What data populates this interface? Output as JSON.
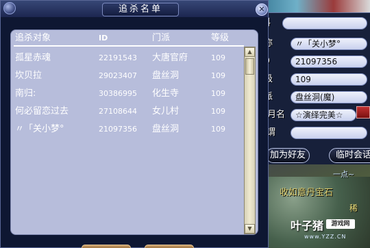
{
  "list_window": {
    "title": "追杀名单",
    "close_icon": "close-icon",
    "columns": {
      "name": "追杀对象",
      "id": "ID",
      "school": "门派",
      "level": "等级"
    },
    "rows": [
      {
        "name": "孤星赤魂",
        "id": "22191543",
        "school": "大唐官府",
        "level": "109"
      },
      {
        "name": "坎贝拉",
        "id": "29023407",
        "school": "盘丝洞",
        "level": "109"
      },
      {
        "name": "南归:",
        "id": "30386995",
        "school": "化生寺",
        "level": "109"
      },
      {
        "name": "何必留恋过去",
        "id": "27108644",
        "school": "女儿村",
        "level": "109"
      },
      {
        "name": "〃「关小梦°",
        "id": "21097356",
        "school": "盘丝洞",
        "level": "109"
      }
    ],
    "scrollbar": {
      "up_icon": "scroll-up-arrow-icon",
      "down_icon": "scroll-down-arrow-icon"
    }
  },
  "info_panel": {
    "fields": [
      {
        "label": "称",
        "value": "〃「关小梦°"
      },
      {
        "label": "ID",
        "value": "21097356"
      },
      {
        "label": "级",
        "value": "109"
      },
      {
        "label": "派",
        "value": "盘丝洞(魔)"
      },
      {
        "label": "月名",
        "value": "☆演绎完美☆"
      },
      {
        "label": "谓",
        "value": ""
      }
    ],
    "partial_header": "料",
    "buttons": {
      "add_friend": "加为好友",
      "temp_chat": "临时会话"
    }
  },
  "scene": {
    "text_a": "收如意丹宝石",
    "text_b": "一点~",
    "text_c": "稀"
  },
  "watermark": {
    "brand": "叶子猪",
    "tag": "游戏网",
    "url": "www.YZZ.CN"
  },
  "colors": {
    "window_bg": "#0e1732",
    "list_bg": "#b7bddb",
    "title_bar": "#2c3966",
    "text": "#ffffff",
    "field_bg": "#e6eaf8"
  }
}
